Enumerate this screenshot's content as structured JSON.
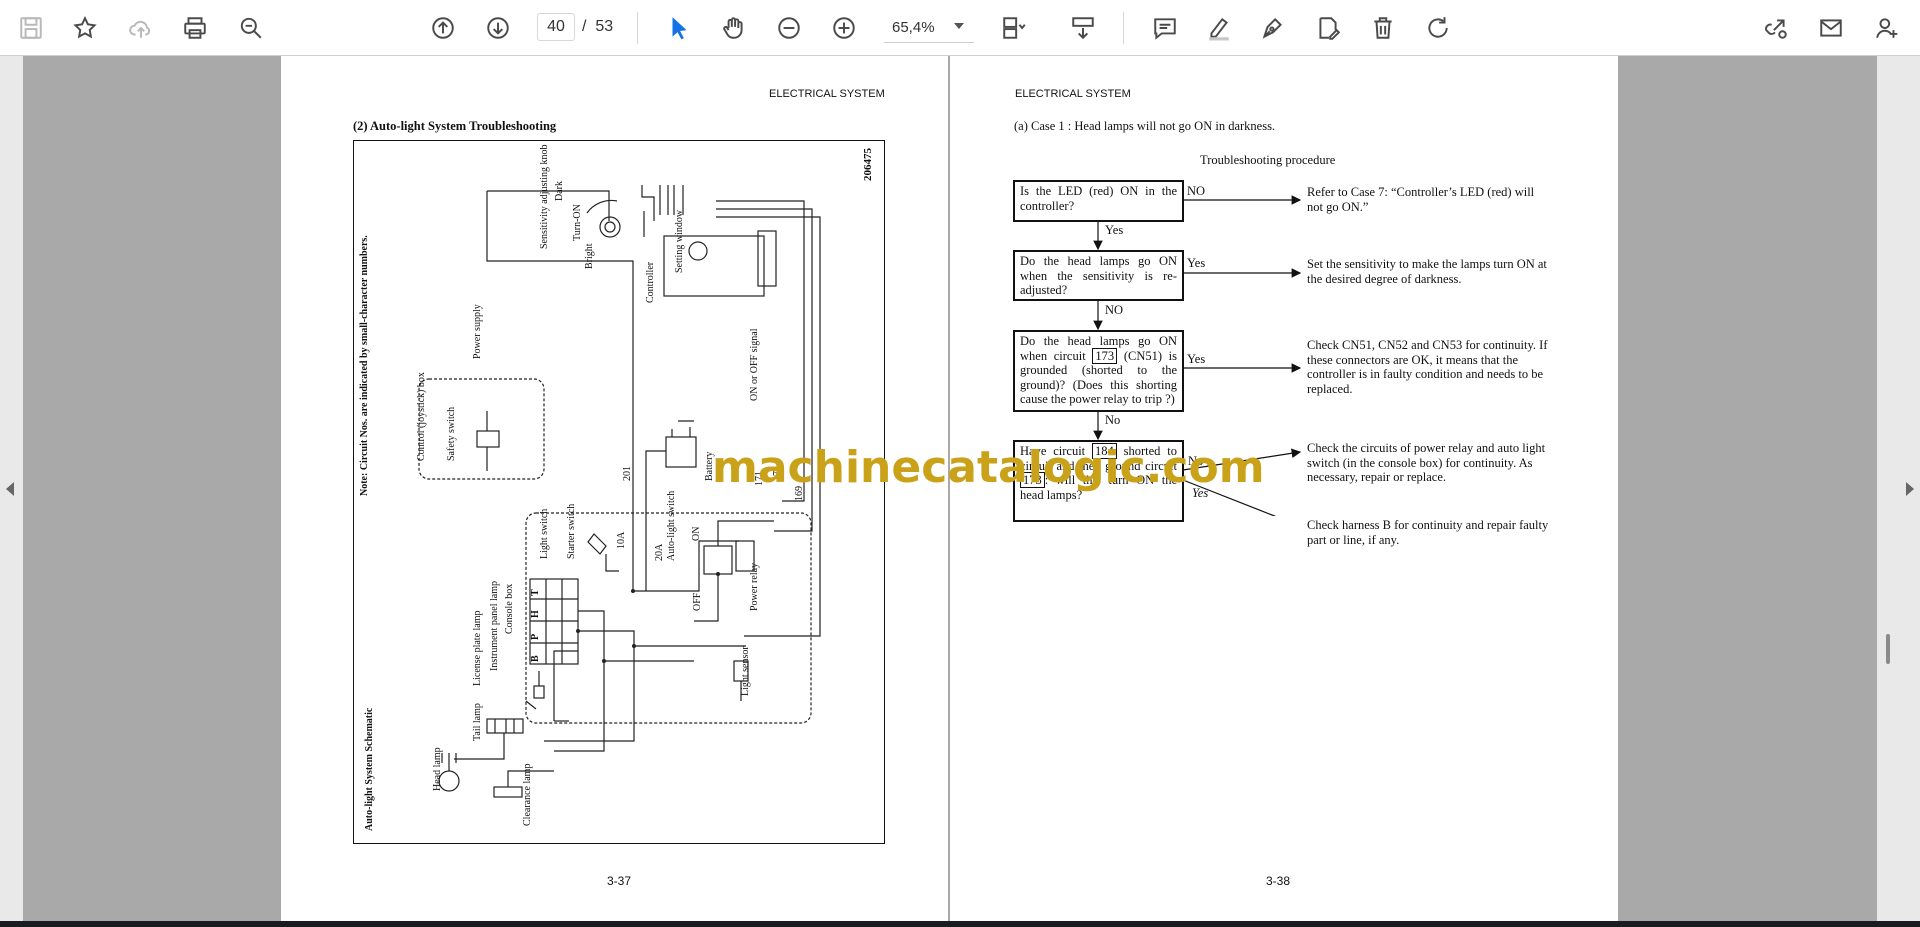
{
  "toolbar": {
    "page_current": "40",
    "page_separator": "/",
    "page_total": "53",
    "zoom": "65,4%",
    "icons": [
      "save-icon",
      "bookmark-star-icon",
      "upload-cloud-icon",
      "print-icon",
      "zoom-search-icon",
      "page-up-icon",
      "page-down-icon",
      "select-cursor-icon",
      "hand-tool-icon",
      "zoom-out-icon",
      "zoom-in-icon",
      "fit-page-icon",
      "scroll-mode-icon",
      "comment-icon",
      "highlight-pen-icon",
      "draw-pen-icon",
      "fill-sign-icon",
      "delete-icon",
      "rotate-icon",
      "share-link-icon",
      "email-icon",
      "add-user-icon"
    ]
  },
  "left_page": {
    "header": "ELECTRICAL SYSTEM",
    "section_title": "(2)  Auto-light System Troubleshooting",
    "page_number": "3-37",
    "schematic": {
      "figure_id": "206475",
      "note": "Note: Circuit Nos. are indicated by small-character numbers.",
      "title": "Auto-light System Schematic",
      "labels": {
        "sensitivity_knob": "Sensitivity adjusting knob",
        "dark": "Dark",
        "turn_on": "Turn-ON",
        "bright": "Bright",
        "controller": "Controller",
        "setting_window": "Setting window",
        "power_supply": "Power supply",
        "control_box": "Control (joystick) box",
        "safety_switch": "Safety switch",
        "on_off_signal": "ON or OFF signal",
        "battery": "Battery",
        "starter_switch": "Starter switch",
        "light_switch": "Light switch",
        "console_box": "Console box",
        "instrument_lamp": "Instrument panel lamp",
        "license_lamp": "License plate lamp",
        "tail_lamp": "Tail lamp",
        "head_lamp": "Head lamp",
        "clearance_lamp": "Clearance lamp",
        "auto_light_switch": "Auto-light switch",
        "on": "ON",
        "off": "OFF",
        "power_relay": "Power relay",
        "light_sensor": "Light sensor",
        "fuse_10a": "10A",
        "fuse_20a": "20A",
        "wire_201": "201",
        "wire_173": "173",
        "wire_171": "171",
        "wire_169": "169",
        "switch_letters": [
          "T",
          "H",
          "P",
          "B"
        ]
      }
    }
  },
  "right_page": {
    "header": "ELECTRICAL SYSTEM",
    "case_title": "(a)  Case 1 : Head lamps will not go ON in darkness.",
    "procedure_title": "Troubleshooting procedure",
    "page_number": "3-38",
    "steps": [
      {
        "question": "Is the LED (red) ON in the controller?",
        "branch_right": "NO",
        "result": "Refer to Case 7: “Controller’s LED (red) will not go ON.”",
        "branch_down": "Yes"
      },
      {
        "question": "Do the head lamps go ON when the sensitivity is re-adjusted?",
        "branch_right": "Yes",
        "result": "Set the sensitivity to make the lamps turn ON at the desired degree of darkness.",
        "branch_down": "NO"
      },
      {
        "q_part1": "Do the head lamps go ON when circuit",
        "q_code": "173",
        "q_part2": "(CN51) is grounded (shorted to the ground)? (Does this shorting cause the power relay to trip ?)",
        "branch_right": "Yes",
        "result": "Check CN51, CN52 and CN53 for continuity. If these connectors are OK, it means that the controller is in faulty condition and needs to be replaced.",
        "branch_down": "No"
      },
      {
        "q_part1": "Have circuit",
        "q_code1": "184",
        "q_part2": "shorted to circuit  and then ground circuit",
        "q_code2": "173",
        "q_part3": ": will this turn ON the head lamps?",
        "branch_no": "No",
        "branch_yes": "Yes",
        "result_no": "Check the circuits of power relay and auto light switch (in the console box) for continuity. As necessary, repair or replace.",
        "result_yes": "Check harness B for continuity and repair faulty part or line, if any."
      }
    ]
  },
  "watermark": "machinecatalogic.com",
  "colors": {
    "watermark": "#c9a21a",
    "active_tool": "#1473e6",
    "viewer_bg": "#a9a9a9"
  }
}
